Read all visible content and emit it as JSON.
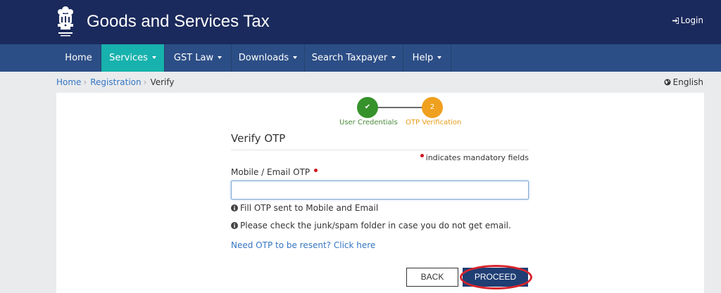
{
  "header": {
    "title": "Goods and Services Tax",
    "emblem_caption": "सत्यमेव जयते",
    "login_label": "Login"
  },
  "nav": {
    "items": [
      {
        "label": "Home",
        "dropdown": false
      },
      {
        "label": "Services",
        "dropdown": true,
        "active": true
      },
      {
        "label": "GST Law",
        "dropdown": true
      },
      {
        "label": "Downloads",
        "dropdown": true
      },
      {
        "label": "Search Taxpayer",
        "dropdown": true
      },
      {
        "label": "Help",
        "dropdown": true
      }
    ]
  },
  "breadcrumb": {
    "items": [
      "Home",
      "Registration"
    ],
    "current": "Verify"
  },
  "language": "English",
  "stepper": {
    "step1_label": "User Credentials",
    "step1_mark": "✔",
    "step2_label": "OTP Verification",
    "step2_number": "2"
  },
  "form": {
    "title": "Verify OTP",
    "mandatory_note": "indicates mandatory fields",
    "otp_label": "Mobile / Email OTP",
    "otp_value": "",
    "hint1": "Fill OTP sent to Mobile and Email",
    "hint2": "Please check the junk/spam folder in case you do not get email.",
    "resend_link": "Need OTP to be resent? Click here",
    "back_label": "BACK",
    "proceed_label": "PROCEED"
  },
  "colors": {
    "header_bg": "#1b2a5c",
    "nav_bg": "#2c4e86",
    "nav_active": "#17b2ad",
    "step_done": "#36922b",
    "step_current": "#efa01e",
    "proceed_bg": "#1f3e74",
    "annotation_ring": "#d8242c"
  }
}
